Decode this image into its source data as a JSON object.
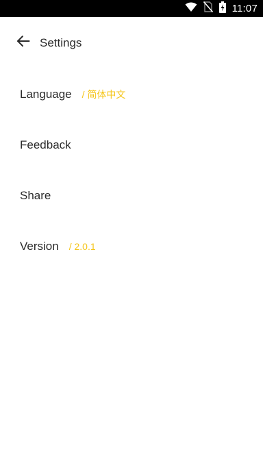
{
  "status_bar": {
    "time": "11:07",
    "icons": [
      "wifi-icon",
      "no-sim-icon",
      "battery-charging-icon"
    ]
  },
  "header": {
    "title": "Settings",
    "back_icon": "arrow-left-icon"
  },
  "settings": {
    "items": [
      {
        "label": "Language",
        "value": "/ 简体中文"
      },
      {
        "label": "Feedback"
      },
      {
        "label": "Share"
      },
      {
        "label": "Version",
        "value": "/ 2.0.1"
      }
    ]
  },
  "colors": {
    "accent": "#F5C518",
    "text": "#2A2A2A",
    "status_bar_bg": "#000000"
  }
}
